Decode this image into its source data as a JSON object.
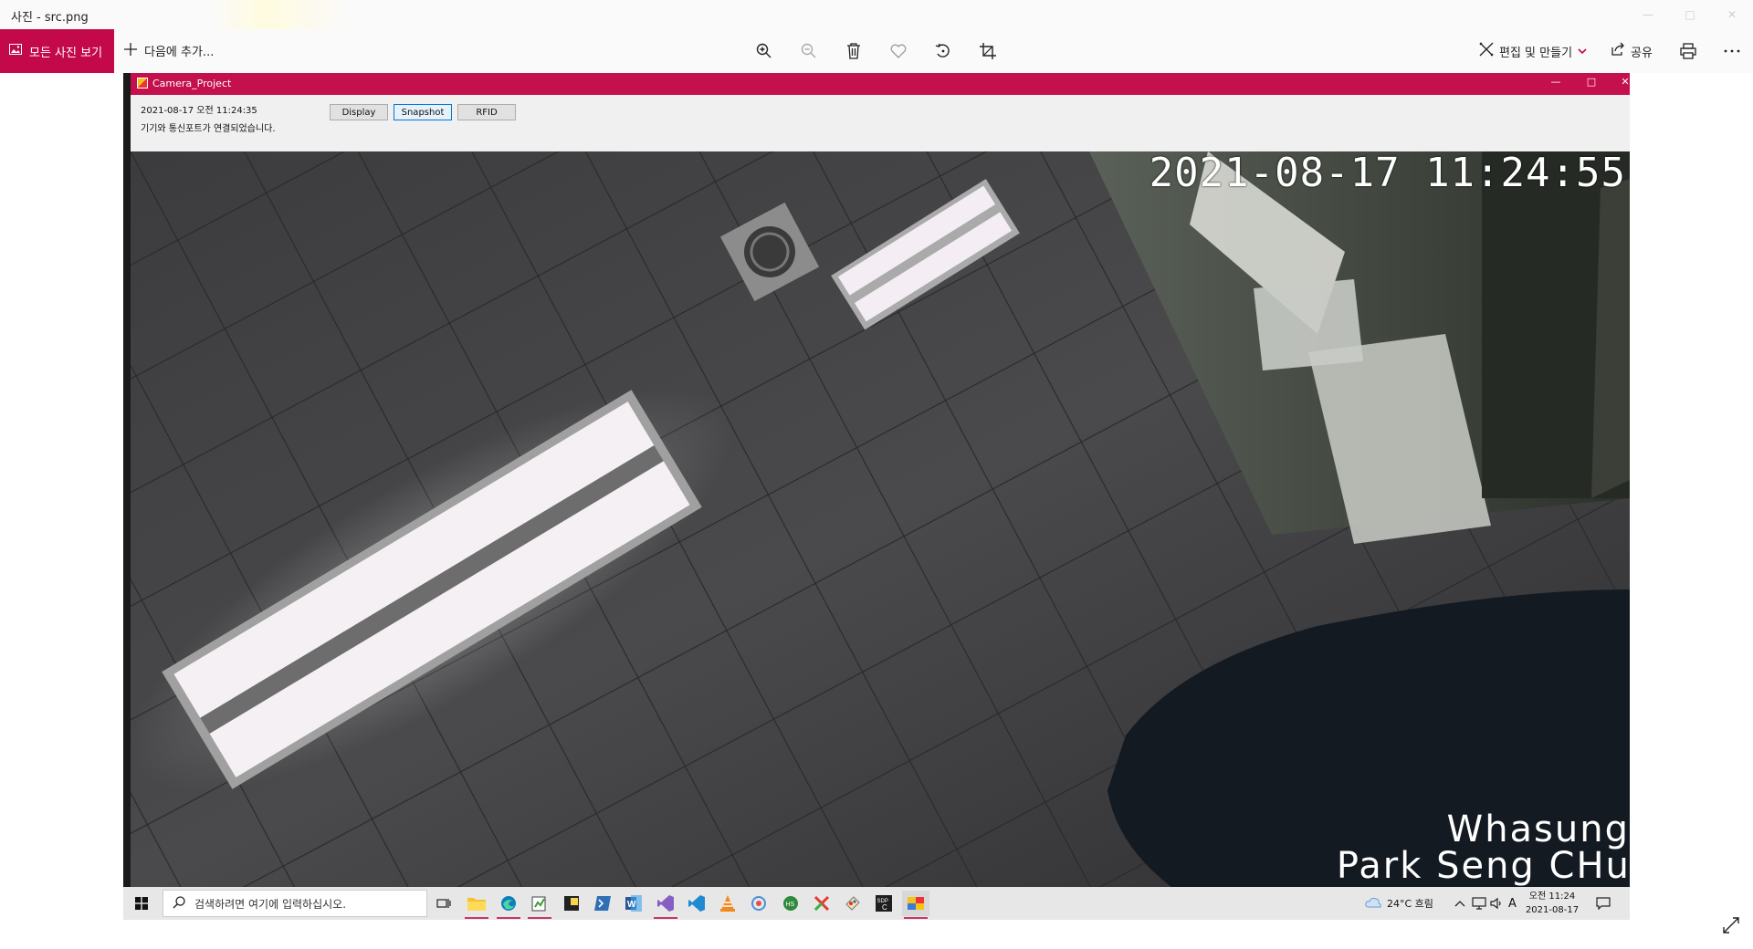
{
  "app": {
    "title": "사진 - src.png",
    "toolbar": {
      "all_photos_label": "모든 사진 보기",
      "add_to_label": "다음에 추가...",
      "edit_create_label": "편집 및 만들기",
      "share_label": "공유"
    },
    "icons": [
      "zoom-in-icon",
      "zoom-out-icon",
      "delete-icon",
      "favorite-icon",
      "rotate-icon",
      "crop-icon",
      "edit-icon",
      "share-icon",
      "print-icon",
      "more-icon",
      "expand-icon"
    ]
  },
  "camera_window": {
    "title": "Camera_Project",
    "datetime": "2021-08-17 오전 11:24:35",
    "status": "기기와 통신포트가 연결되었습니다.",
    "buttons": {
      "display": "Display",
      "snapshot": "Snapshot",
      "rfid": "RFID"
    },
    "feed": {
      "timestamp_osd": "2021-08-17 11:24:55",
      "caption_line1": "Whasung",
      "caption_line2": "Park Seng CHul"
    }
  },
  "taskbar": {
    "search_placeholder": "검색하려면 여기에 입력하십시오.",
    "weather": "24°C  흐림",
    "ime_indicator": "A",
    "clock_time": "오전 11:24",
    "clock_date": "2021-08-17",
    "pinned_apps": [
      "task-view",
      "file-explorer",
      "edge",
      "notepad-plus",
      "sticky-notes",
      "powershell",
      "word",
      "visual-studio",
      "vscode",
      "vlc",
      "network-tool",
      "hs-app",
      "xmind",
      "paint",
      "sdcc",
      "camera-project"
    ]
  },
  "colors": {
    "accent": "#c4094b",
    "camera_titlebar": "#c4104d",
    "taskbar": "#e7e7e7"
  }
}
